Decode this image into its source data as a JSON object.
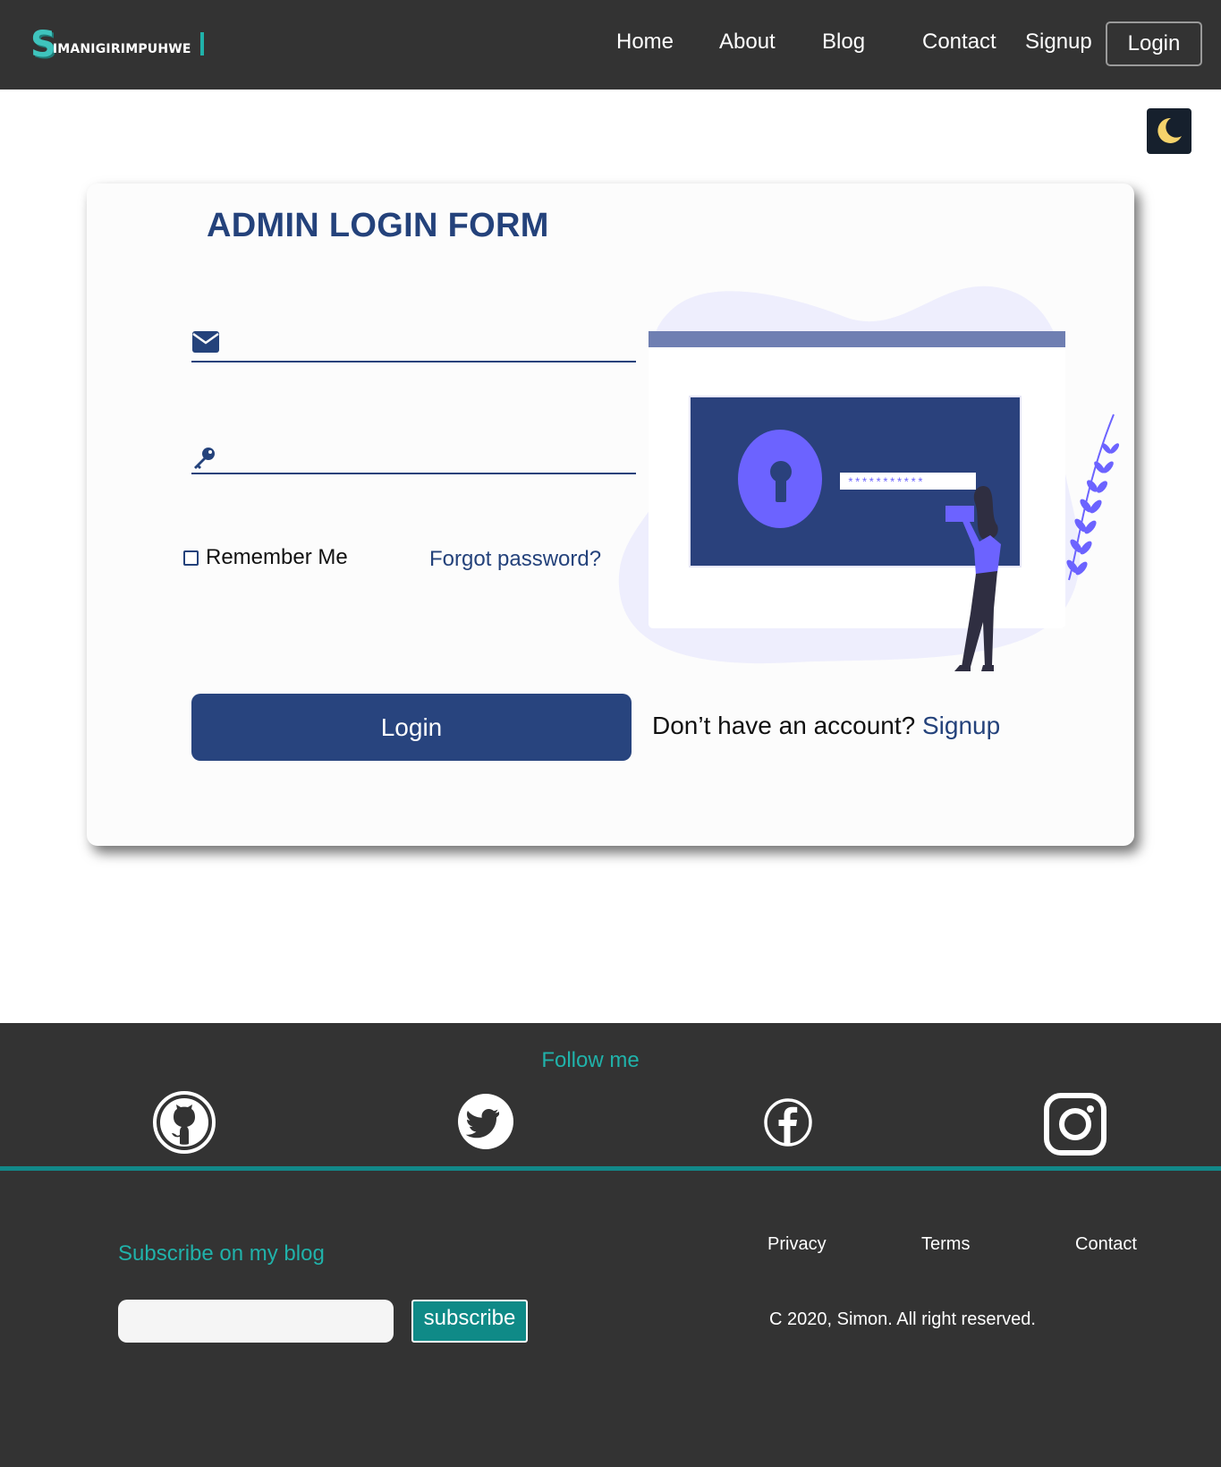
{
  "navbar": {
    "logo_initial": "S",
    "logo_text": "IMANIGIRIMPUHWE",
    "links": [
      "Home",
      "About",
      "Blog",
      "Contact",
      "Signup"
    ],
    "login_label": "Login"
  },
  "theme_toggle": {
    "icon": "moon-icon",
    "icon_color": "#f5d36b",
    "bg_color": "#16202d"
  },
  "form": {
    "title": "ADMIN LOGIN FORM",
    "email_icon": "envelope-icon",
    "email_placeholder": "",
    "password_icon": "key-icon",
    "password_placeholder": "",
    "remember_label": "Remember Me",
    "remember_checked": false,
    "forgot_label": "Forgot password?",
    "login_label": "Login",
    "no_account_text": "Don’t have an account?",
    "signup_label": "Signup",
    "illustration_password_mask": "***********"
  },
  "footer": {
    "follow_label": "Follow me",
    "social": [
      "github-icon",
      "twitter-icon",
      "facebook-icon",
      "instagram-icon"
    ],
    "subscribe_title": "Subscribe on my blog",
    "subscribe_placeholder": "",
    "subscribe_label": "subscribe",
    "links": [
      "Privacy",
      "Terms",
      "Contact"
    ],
    "copyright": "C 2020, Simon. All right reserved."
  },
  "colors": {
    "navbar_bg": "#333333",
    "accent_teal": "#20b2aa",
    "primary_blue": "#28447e",
    "illustration_purple": "#6c63ff"
  }
}
